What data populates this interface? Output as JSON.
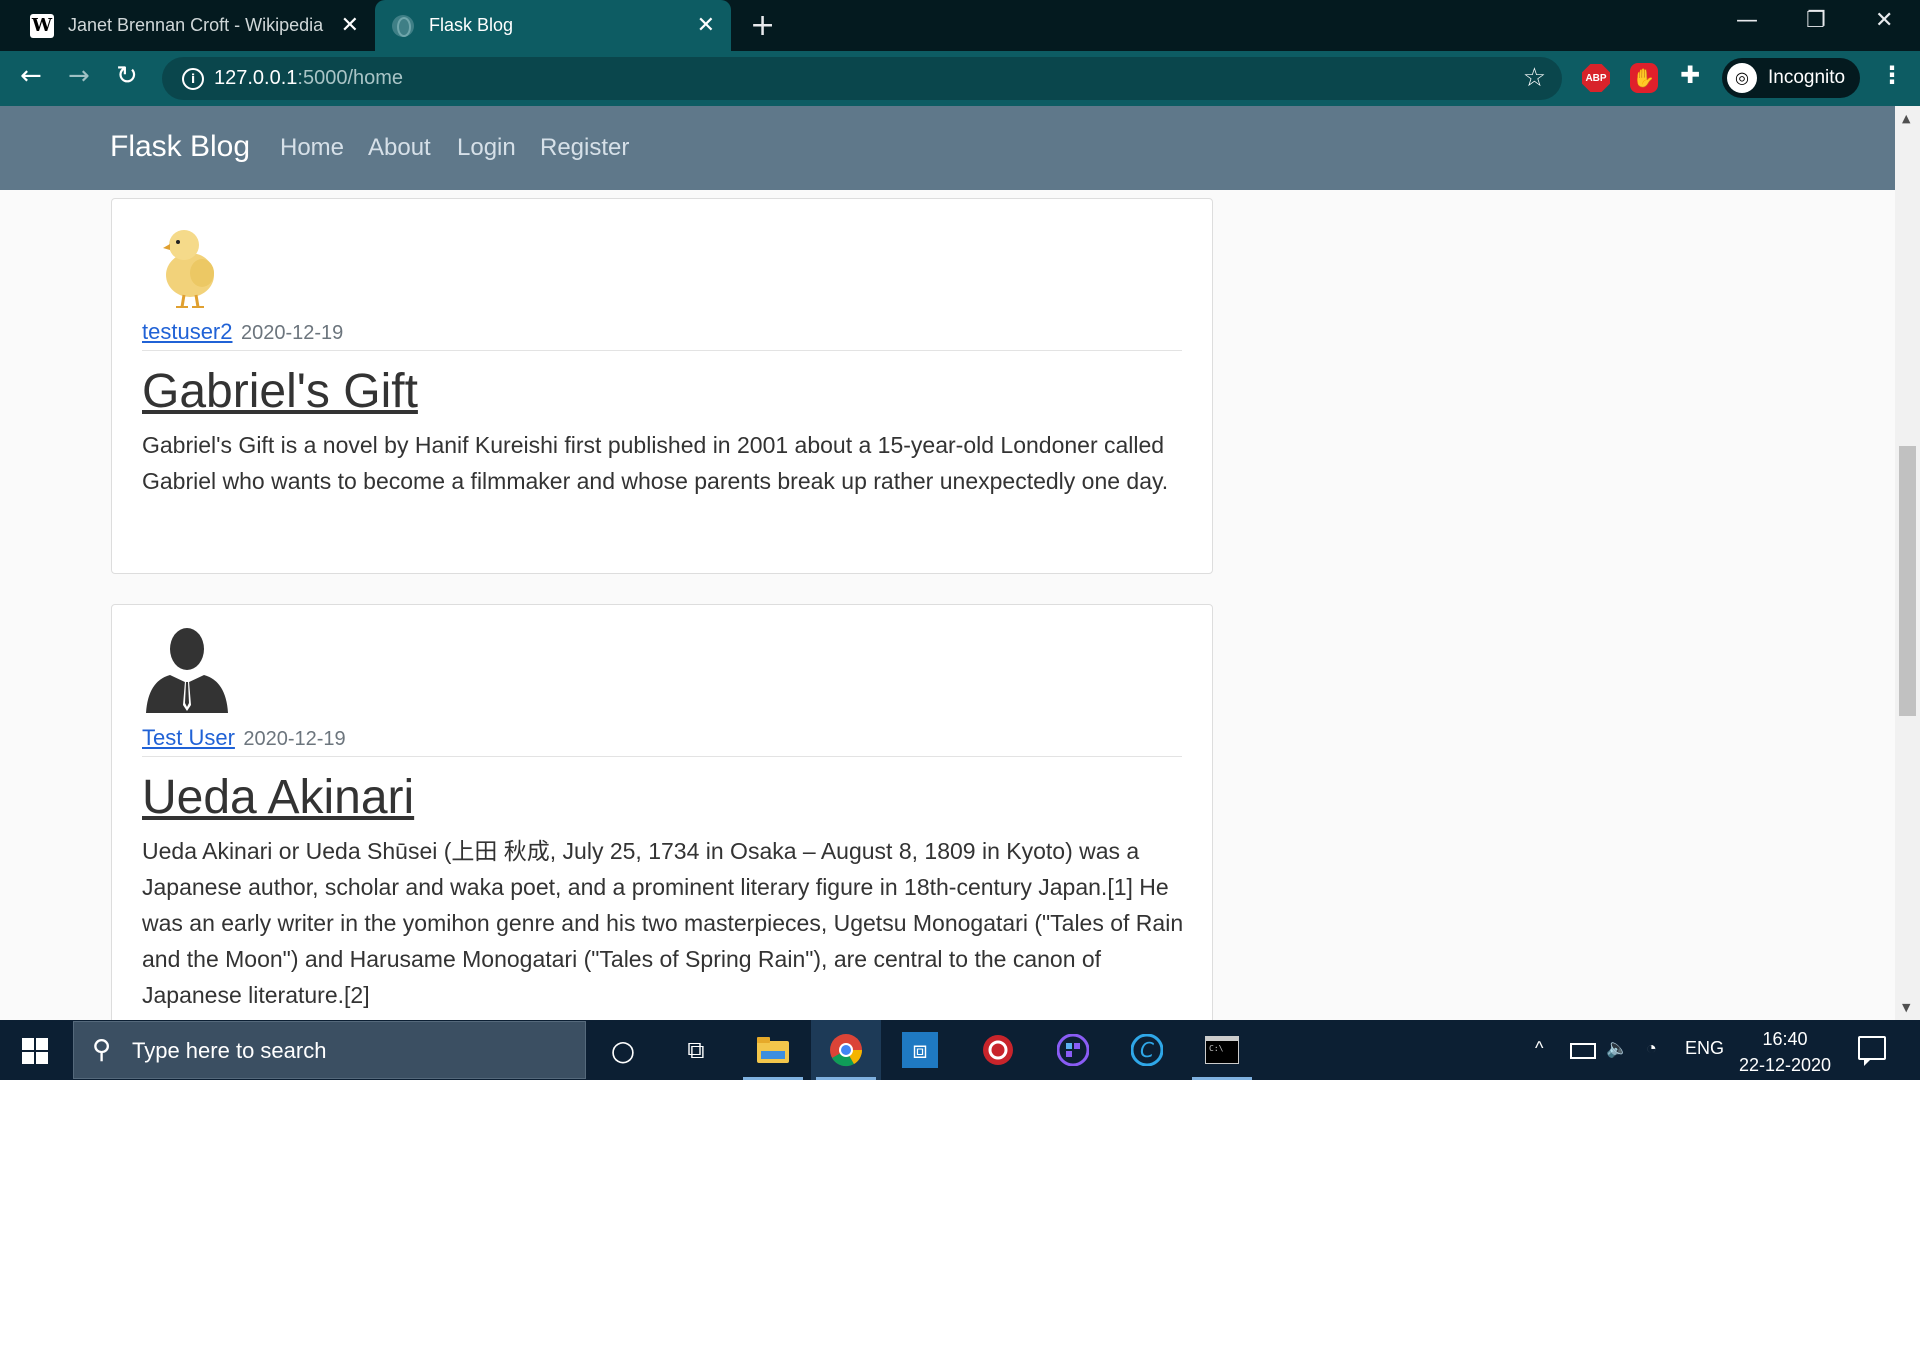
{
  "browser": {
    "tabs": [
      {
        "title": "Janet Brennan Croft - Wikipedia",
        "icon": "wikipedia-icon",
        "active": false
      },
      {
        "title": "Flask Blog",
        "icon": "globe-icon",
        "active": true
      }
    ],
    "address": {
      "host": "127.0.0.1",
      "path": ":5000/home"
    },
    "profile_label": "Incognito",
    "extensions": {
      "abp_label": "ABP"
    },
    "accent_color": "#0d5c63"
  },
  "site": {
    "brand": "Flask Blog",
    "nav": [
      "Home",
      "About",
      "Login",
      "Register"
    ],
    "navbar_color": "#5f788a"
  },
  "posts": [
    {
      "author": "testuser2",
      "date": "2020-12-19",
      "avatar": "chick-image",
      "title": "Gabriel's Gift",
      "body": "Gabriel's Gift is a novel by Hanif Kureishi first published in 2001 about a 15-year-old Londoner called Gabriel who wants to become a filmmaker and whose parents break up rather unexpectedly one day."
    },
    {
      "author": "Test User",
      "date": "2020-12-19",
      "avatar": "person-silhouette-image",
      "title": "Ueda Akinari",
      "body": "Ueda Akinari or Ueda Shūsei (上田 秋成, July 25, 1734 in Osaka – August 8, 1809 in Kyoto) was a Japanese author, scholar and waka poet, and a prominent literary figure in 18th-century Japan.[1] He was an early writer in the yomihon genre and his two masterpieces, Ugetsu Monogatari (\"Tales of Rain and the Moon\") and Harusame Monogatari (\"Tales of Spring Rain\"), are central to the canon of Japanese literature.[2]"
    }
  ],
  "taskbar": {
    "search_placeholder": "Type here to search",
    "tray_language": "ENG",
    "time": "16:40",
    "date": "22-12-2020"
  }
}
